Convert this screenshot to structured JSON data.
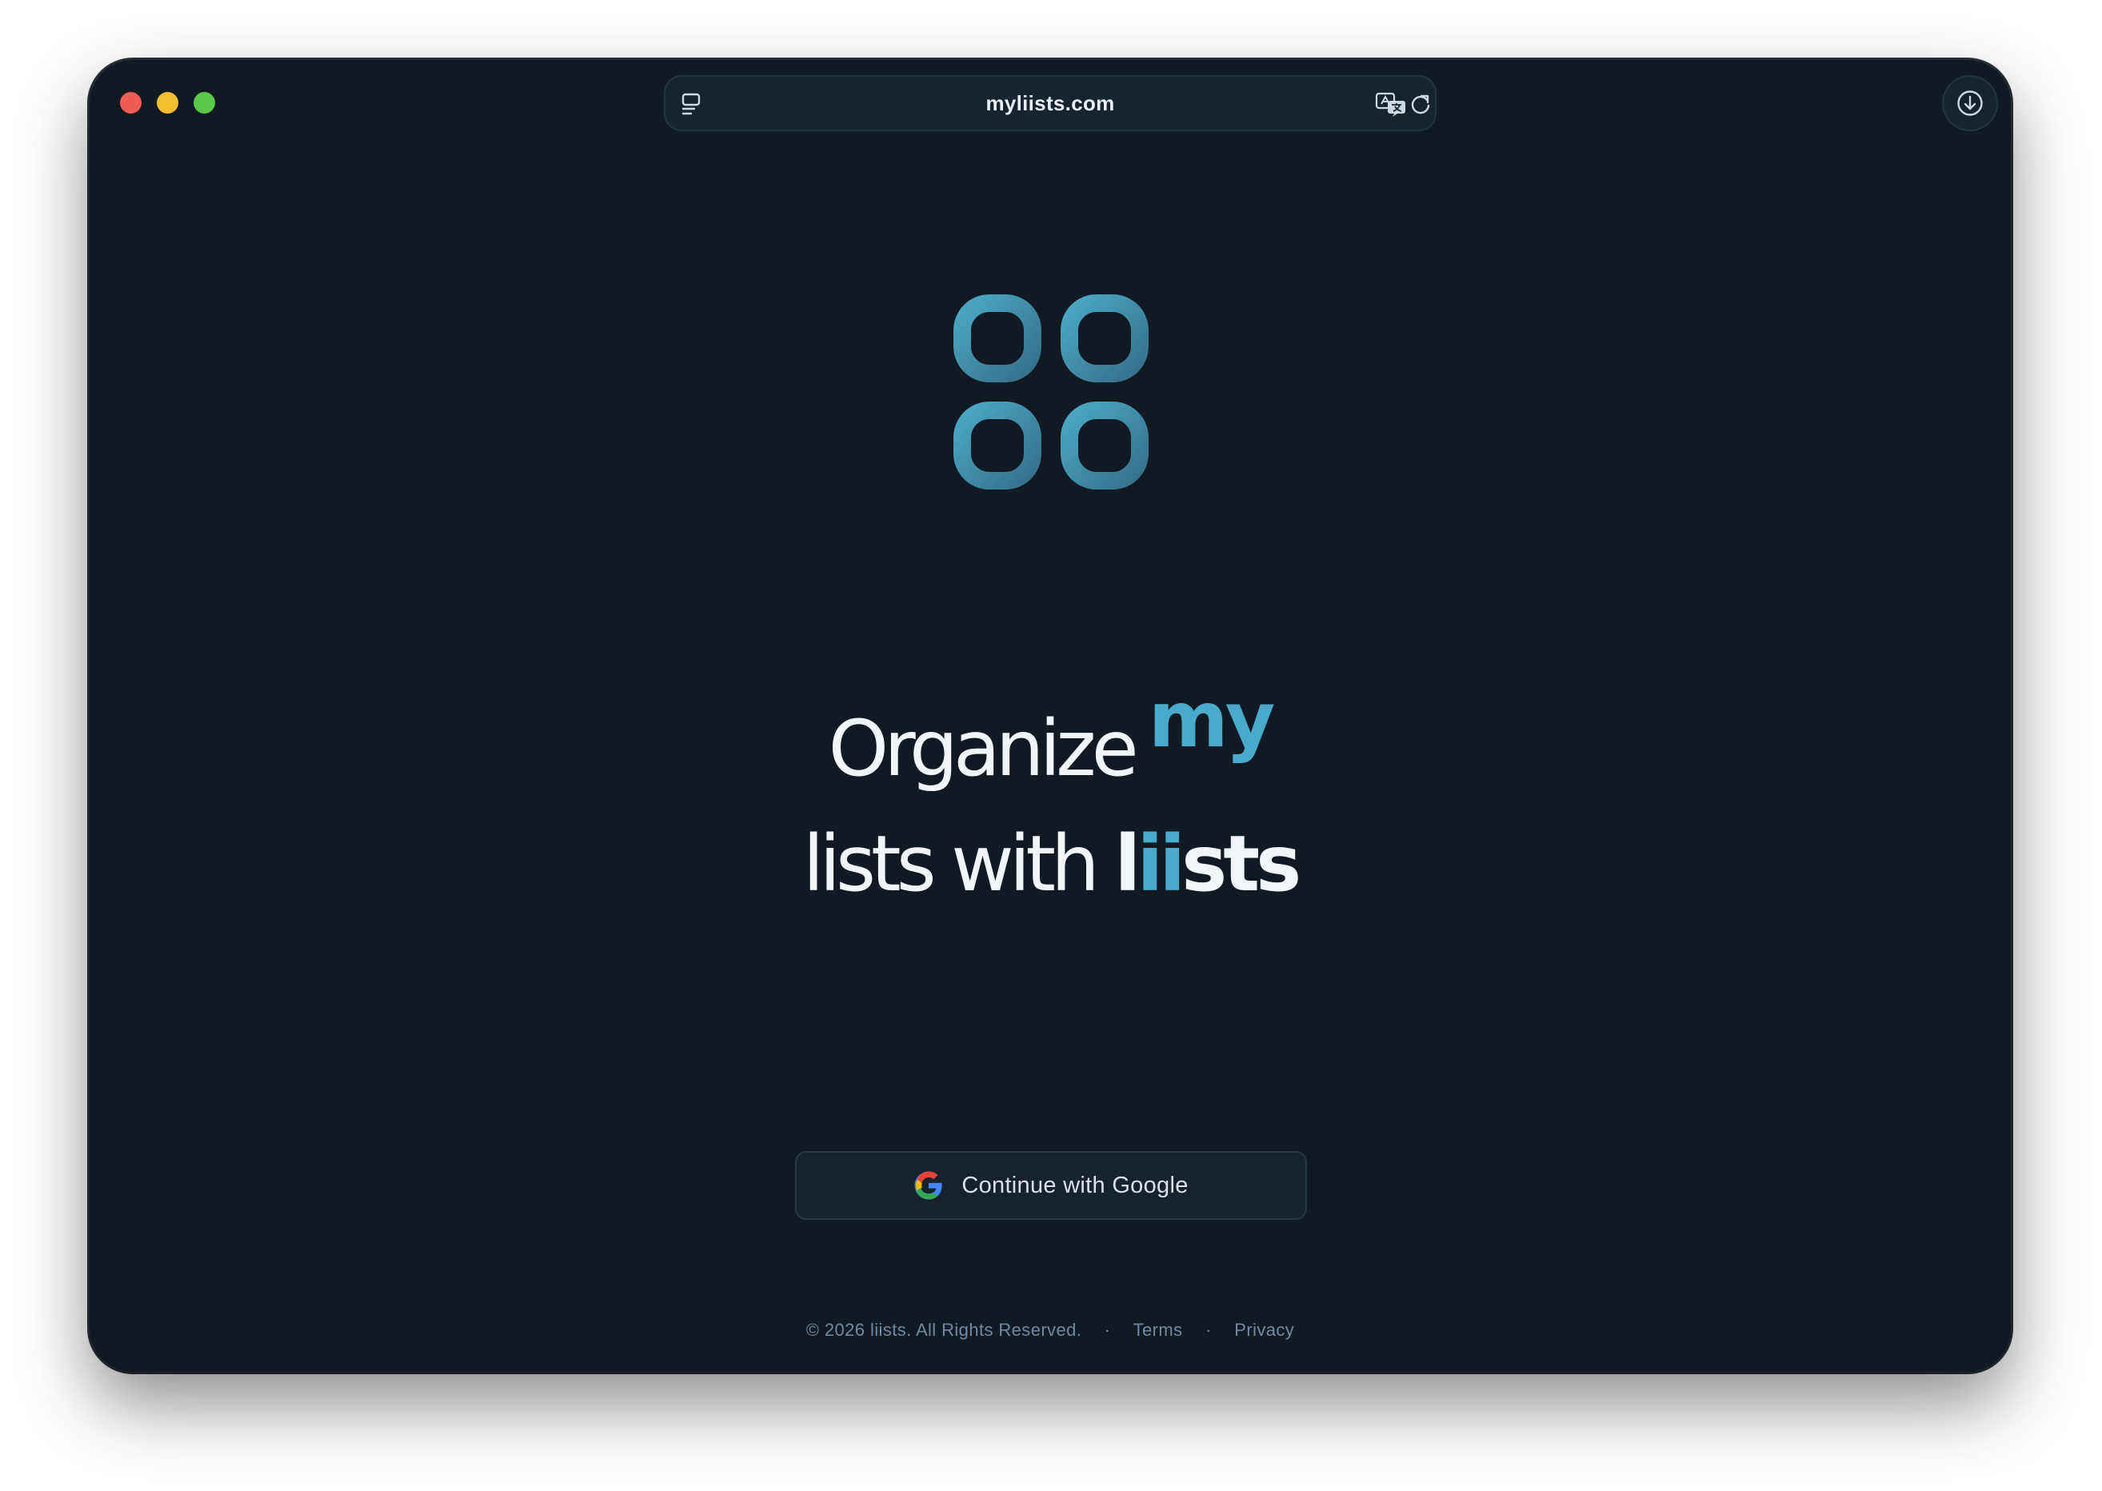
{
  "browser": {
    "url": "myliists.com"
  },
  "hero": {
    "line1_text": "Organize",
    "line1_accent": "my",
    "line2_text": "lists with ",
    "brand_start": "l",
    "brand_accent": "ii",
    "brand_end": "sts"
  },
  "auth": {
    "google_label": "Continue with Google"
  },
  "footer": {
    "copyright": "© 2026 liists. All Rights Reserved.",
    "separator": "·",
    "terms": "Terms",
    "privacy": "Privacy"
  },
  "colors": {
    "background": "#111a22",
    "accent": "#49aacb",
    "logo_top": "#4aa8c6",
    "logo_bottom": "#36708a"
  },
  "icons": {
    "sidebar": "sidebar-icon",
    "translate": "translate-icon",
    "reload": "reload-icon",
    "download": "download-icon",
    "google": "google-g-icon",
    "logo": "four-rounded-squares-logo"
  }
}
